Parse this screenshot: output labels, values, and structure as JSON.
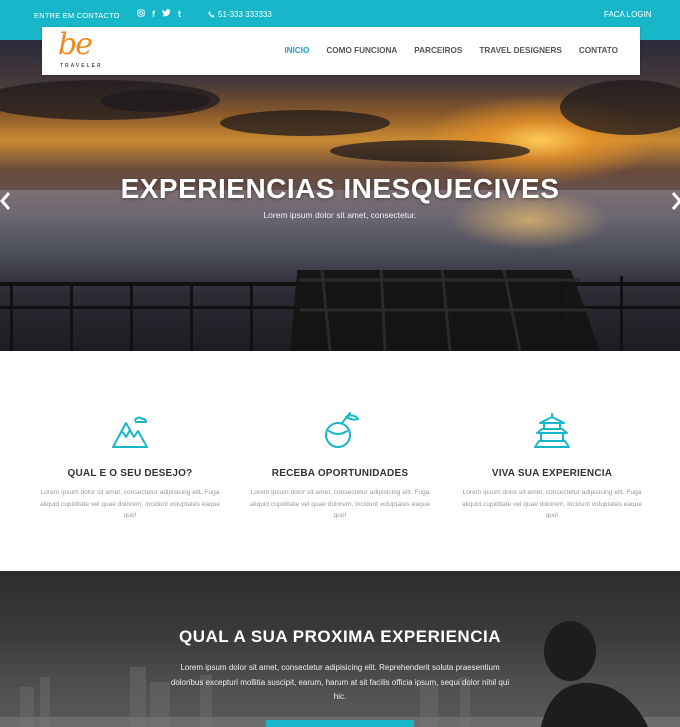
{
  "topbar": {
    "contact_label": "ENTRE EM CONTACTO",
    "social": [
      "instagram-icon",
      "facebook-icon",
      "twitter-icon",
      "tumblr-icon"
    ],
    "phone": "51-333 333333",
    "login_label": "FACA LOGIN",
    "color": "#17b7c9"
  },
  "logo": {
    "main": "be",
    "sub": "TRAVELER"
  },
  "nav": {
    "items": [
      {
        "label": "INICIO",
        "active": true
      },
      {
        "label": "COMO FUNCIONA"
      },
      {
        "label": "PARCEIROS"
      },
      {
        "label": "TRAVEL DESIGNERS"
      },
      {
        "label": "CONTATO"
      }
    ]
  },
  "hero": {
    "title": "EXPERIENCIAS INESQUECIVES",
    "subtitle": "Lorem ipsum dolor sit amet, consectetur.",
    "prev_icon": "chevron-left-icon",
    "next_icon": "chevron-right-icon"
  },
  "features": [
    {
      "icon": "mountain-icon",
      "title": "QUAL E O SEU DESEJO?",
      "text": "Lorem ipsum dolor sit amet, consectetur adipisicing elit. Fuga aliquid cupiditate vel quae dolorem, incidunt voluptates eaque quo!"
    },
    {
      "icon": "coconut-drink-icon",
      "title": "RECEBA OPORTUNIDADES",
      "text": "Lorem ipsum dolor sit amet, consectetur adipisicing elit. Fuga aliquid cupiditate vel quae dolorem, incidunt voluptates eaque quo!"
    },
    {
      "icon": "pagoda-icon",
      "title": "VIVA SUA EXPERIENCIA",
      "text": "Lorem ipsum dolor sit amet, consectetur adipisicing elit. Fuga aliquid cupiditate vel quae dolorem, incidunt voluptates eaque quo!"
    }
  ],
  "next_section": {
    "title": "QUAL A SUA PROXIMA EXPERIENCIA",
    "text": "Lorem ipsum dolor sit amet, consectetur adipisicing elit. Reprehenderit soluta praesentium doloribus excepturi mollitia suscipit, earum, harum at sit facilis officia ipsum, sequi dolor nihil qui hic."
  },
  "colors": {
    "accent": "#17b7c9",
    "nav_active": "#1e9fc9",
    "logo": "#f08a1e"
  }
}
